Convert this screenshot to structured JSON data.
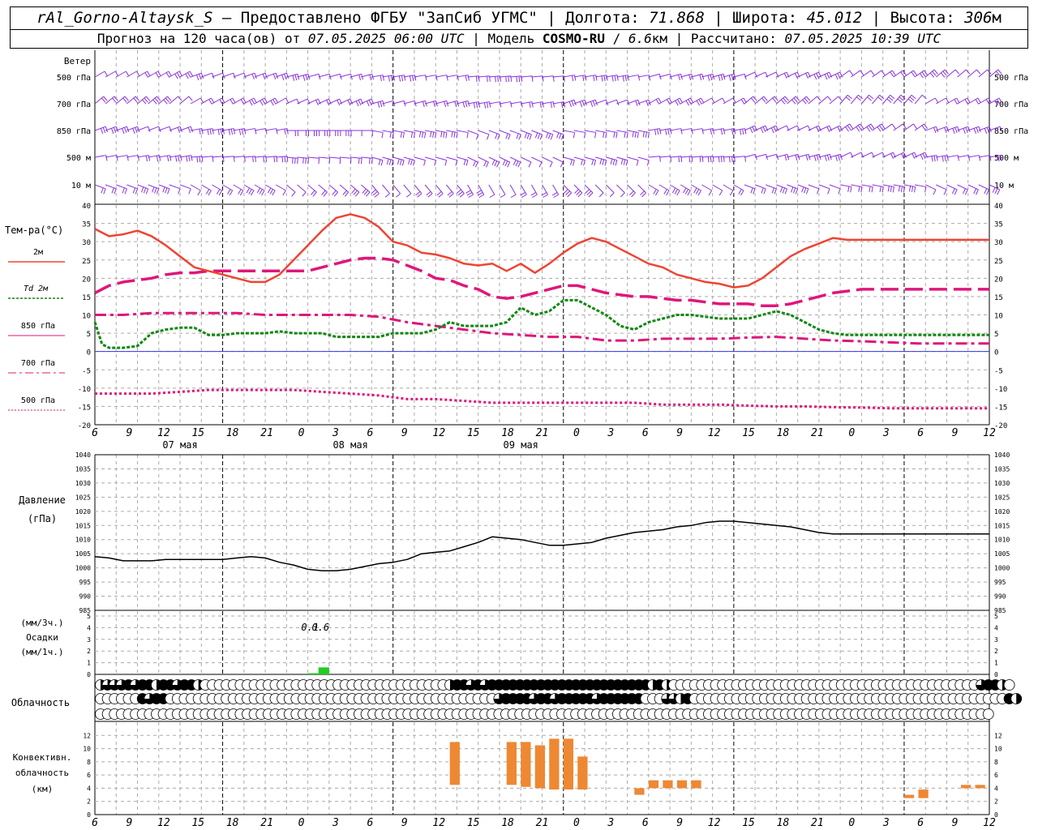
{
  "header": {
    "station": "rAl_Gorno-Altaysk_S",
    "dash": " – ",
    "provided": "Предоставлено ФГБУ \"ЗапСиб УГМС\"",
    "sep": " | ",
    "lon_label": "Долгота: ",
    "lon": "71.868",
    "lat_label": "Широта: ",
    "lat": "45.012",
    "alt_label": "Высота: ",
    "alt": "306",
    "alt_unit": "м",
    "forecast_label": "Прогноз на 120 часа(ов) от ",
    "forecast_time": "07.05.2025 06:00 UTC",
    "model_sep": "  | Модель ",
    "model": "COSMO-RU",
    "model_res_sep": " / ",
    "model_res": "6.6",
    "model_res_unit": "км",
    "calc_label": " | Рассчитано: ",
    "calc_time": "07.05.2025 10:39 UTC"
  },
  "colors": {
    "t2m": "#ee4433",
    "td2m": "#118811",
    "t850": "#e0167a",
    "t700": "#e0167a",
    "t500": "#e0167a",
    "wind": "#8833dd",
    "precip": "#22cc22",
    "convective": "#ee8833",
    "zero_line": "#3333ee",
    "grid": "#aaaaaa"
  },
  "x_axis": {
    "hour_ticks": [
      "6",
      "9",
      "12",
      "15",
      "18",
      "21",
      "0",
      "3",
      "6",
      "9",
      "12",
      "15",
      "18",
      "21",
      "0",
      "3",
      "6",
      "9",
      "12",
      "15",
      "18",
      "21",
      "0",
      "3",
      "6",
      "9",
      "12"
    ],
    "date_labels": [
      "07 мая",
      "08 мая",
      "09 мая"
    ]
  },
  "wind": {
    "title": "Ветер",
    "levels": [
      "500 гПа",
      "700 гПа",
      "850 гПа",
      "500 м",
      "10  м"
    ]
  },
  "temperature": {
    "label": "Тем-ра(°C)",
    "legend": [
      {
        "key": "t2m",
        "label": "2м"
      },
      {
        "key": "td2m",
        "label": "Td 2м"
      },
      {
        "key": "t850",
        "label": "850 гПа"
      },
      {
        "key": "t700",
        "label": "700 гПа"
      },
      {
        "key": "t500",
        "label": "500 гПа"
      }
    ],
    "y_ticks": [
      "40",
      "35",
      "30",
      "25",
      "20",
      "15",
      "10",
      "5",
      "0",
      "-5",
      "-10",
      "-15",
      "-20"
    ]
  },
  "pressure": {
    "label1": "Давление",
    "label2": "(гПа)",
    "y_ticks": [
      "1040",
      "1035",
      "1030",
      "1025",
      "1020",
      "1015",
      "1010",
      "1005",
      "1000",
      "995",
      "990",
      "985"
    ]
  },
  "precip": {
    "label1": "(мм/3ч.)",
    "label2": "Осадки",
    "label3": "(мм/1ч.)",
    "y_ticks": [
      "5",
      "4",
      "3",
      "2",
      "1",
      "0"
    ],
    "value_labels": [
      "0.1",
      "0.6"
    ]
  },
  "cloud": {
    "label": "Облачность"
  },
  "convective": {
    "label1": "Конвективн.",
    "label2": "облачность",
    "label3": "(км)",
    "y_ticks": [
      "12",
      "10",
      "8",
      "6",
      "4",
      "2",
      "0"
    ]
  },
  "chart_data": {
    "type": "meteogram",
    "x_hours_from_start": "0..126, start 07.05.2025 06:00 UTC",
    "t2m": {
      "x": [
        0,
        2,
        4,
        6,
        8,
        10,
        12,
        14,
        16,
        18,
        20,
        22,
        24,
        26,
        28,
        30,
        32,
        34,
        36,
        38,
        40,
        42,
        44,
        46,
        48,
        50,
        52,
        54,
        56,
        58,
        60,
        62,
        64,
        66,
        68,
        70,
        72,
        74,
        76,
        78,
        80,
        82,
        84,
        86,
        88,
        90,
        92,
        94,
        96,
        98,
        100,
        102,
        104,
        106,
        108,
        110,
        112,
        114,
        116,
        118,
        120,
        122,
        124,
        126
      ],
      "y": [
        33.5,
        31.5,
        32,
        33,
        31.5,
        29,
        26,
        23,
        22,
        21,
        20,
        19,
        19,
        21,
        25,
        29,
        33,
        36.5,
        37.5,
        36.5,
        34,
        30,
        29,
        27,
        26.5,
        25.5,
        24,
        23.5,
        24,
        22,
        24,
        21.5,
        24,
        27,
        29.5,
        31,
        30,
        28,
        26,
        24,
        23,
        21,
        20,
        19,
        18.5,
        17.5,
        18,
        20,
        23,
        26,
        28,
        29.5,
        31,
        30.5,
        30.5,
        30.5,
        30.5,
        30.5,
        30.5,
        30.5,
        30.5,
        30.5,
        30.5,
        30.5
      ]
    },
    "td2m": {
      "x": [
        0,
        1,
        2,
        4,
        6,
        8,
        10,
        12,
        14,
        16,
        18,
        20,
        22,
        24,
        26,
        28,
        30,
        32,
        34,
        36,
        38,
        40,
        42,
        44,
        46,
        48,
        50,
        52,
        54,
        56,
        58,
        60,
        62,
        64,
        66,
        68,
        70,
        72,
        74,
        76,
        78,
        80,
        82,
        84,
        86,
        88,
        90,
        92,
        94,
        96,
        98,
        100,
        102,
        104,
        106,
        108,
        110,
        112,
        114,
        116,
        118,
        120,
        122,
        124,
        126
      ],
      "y": [
        8,
        2,
        1,
        1,
        1.5,
        5,
        6,
        6.5,
        6.5,
        4.5,
        4.5,
        5,
        5,
        5,
        5.5,
        5,
        5,
        5,
        4,
        4,
        4,
        4,
        5,
        5,
        5,
        6,
        8,
        7,
        7,
        7,
        8,
        12,
        10,
        11,
        14,
        14,
        12,
        10,
        7,
        6,
        8,
        9,
        10,
        10,
        9.5,
        9,
        9,
        9,
        10,
        11,
        10,
        8,
        6,
        5,
        4.5,
        4.5,
        4.5,
        4.5,
        4.5,
        4.5,
        4.5,
        4.5,
        4.5,
        4.5,
        4.5
      ]
    },
    "t850": {
      "x": [
        0,
        2,
        4,
        6,
        8,
        10,
        12,
        14,
        16,
        18,
        20,
        22,
        24,
        26,
        28,
        30,
        32,
        34,
        36,
        38,
        40,
        42,
        44,
        46,
        48,
        50,
        52,
        54,
        56,
        58,
        60,
        62,
        64,
        66,
        68,
        70,
        72,
        74,
        76,
        78,
        80,
        82,
        84,
        86,
        88,
        90,
        92,
        94,
        96,
        98,
        100,
        102,
        104,
        106,
        108,
        110,
        112,
        114,
        116,
        118,
        120,
        122,
        124,
        126
      ],
      "y": [
        16,
        18,
        19,
        19.5,
        20,
        21,
        21.5,
        21.5,
        22,
        22,
        22,
        22,
        22,
        22,
        22,
        22,
        23,
        24,
        25,
        25.5,
        25.5,
        25,
        23.5,
        22,
        20,
        19.5,
        18,
        17,
        15,
        14.5,
        15,
        16,
        17,
        18,
        18,
        17,
        16,
        15.5,
        15,
        15,
        14.5,
        14,
        14,
        13.5,
        13,
        13,
        13,
        12.5,
        12.5,
        13,
        14,
        15,
        16,
        16.5,
        17,
        17,
        17,
        17,
        17,
        17,
        17,
        17,
        17,
        17
      ]
    },
    "t700": {
      "x": [
        0,
        4,
        8,
        12,
        16,
        20,
        24,
        28,
        32,
        36,
        40,
        44,
        48,
        52,
        56,
        60,
        64,
        68,
        72,
        76,
        80,
        84,
        88,
        92,
        96,
        100,
        104,
        108,
        112,
        116,
        120,
        124,
        126
      ],
      "y": [
        10,
        10,
        10.5,
        10.5,
        10.5,
        10.5,
        10,
        10,
        10,
        10,
        9.5,
        8,
        7,
        6,
        5,
        4.5,
        4,
        4,
        3,
        3,
        3.5,
        3.5,
        3.5,
        3.8,
        4,
        3.5,
        3,
        2.8,
        2.5,
        2.2,
        2.2,
        2.2,
        2.2
      ]
    },
    "t500": {
      "x": [
        0,
        4,
        8,
        12,
        16,
        20,
        24,
        28,
        32,
        36,
        40,
        44,
        48,
        52,
        56,
        60,
        64,
        68,
        72,
        76,
        80,
        84,
        88,
        92,
        96,
        100,
        104,
        108,
        112,
        116,
        120,
        124,
        126
      ],
      "y": [
        -11.5,
        -11.5,
        -11.5,
        -11,
        -10.5,
        -10.5,
        -10.5,
        -10.5,
        -11,
        -11.5,
        -12,
        -13,
        -13,
        -13.5,
        -14,
        -14,
        -14,
        -14,
        -14,
        -14,
        -14.5,
        -14.5,
        -14.5,
        -14.8,
        -15,
        -15,
        -15.2,
        -15.3,
        -15.5,
        -15.5,
        -15.5,
        -15.5,
        -15.5
      ]
    },
    "pressure": {
      "x": [
        0,
        2,
        4,
        6,
        8,
        10,
        12,
        14,
        16,
        18,
        20,
        22,
        24,
        26,
        28,
        30,
        32,
        34,
        36,
        38,
        40,
        42,
        44,
        46,
        48,
        50,
        52,
        54,
        56,
        58,
        60,
        62,
        64,
        66,
        68,
        70,
        72,
        74,
        76,
        78,
        80,
        82,
        84,
        86,
        88,
        90,
        92,
        94,
        96,
        98,
        100,
        102,
        104,
        106,
        108,
        110,
        112,
        114,
        116,
        118,
        120,
        122,
        124,
        126
      ],
      "y": [
        1004,
        1003.5,
        1002.5,
        1002.5,
        1002.5,
        1003,
        1003,
        1003,
        1003,
        1003,
        1003.5,
        1004,
        1003.5,
        1002,
        1001,
        999.5,
        999,
        999,
        999.5,
        1000.5,
        1001.5,
        1002,
        1003,
        1005,
        1005.5,
        1006,
        1007.5,
        1009,
        1011,
        1010.5,
        1010,
        1009,
        1008,
        1008,
        1008.5,
        1009,
        1010.5,
        1011.5,
        1012.5,
        1013,
        1013.5,
        1014.5,
        1015,
        1016,
        1016.5,
        1016.5,
        1016,
        1015.5,
        1015,
        1014.5,
        1013.5,
        1012.5,
        1012,
        1012,
        1012,
        1012,
        1012,
        1012,
        1012,
        1012,
        1012,
        1012,
        1012,
        1012
      ]
    },
    "precip_bars": [
      {
        "x_start": 30,
        "x_end": 31.5,
        "value": 0.1
      },
      {
        "x_start": 31.5,
        "x_end": 33,
        "value": 0.6
      }
    ],
    "cloud_rows": [
      [
        2,
        3,
        3,
        3,
        4,
        3,
        4,
        4,
        2,
        4,
        4,
        3,
        4,
        4,
        2,
        0,
        0,
        0,
        0,
        0,
        0,
        0,
        0,
        0,
        0,
        0,
        0,
        0,
        0,
        0,
        0,
        0,
        0,
        0,
        0,
        0,
        0,
        0,
        0,
        0,
        0,
        0,
        0,
        0,
        0,
        0,
        0,
        0,
        0,
        0,
        2,
        4,
        4,
        3,
        4,
        3,
        4,
        4,
        4,
        4,
        4,
        4,
        4,
        4,
        4,
        4,
        4,
        4,
        4,
        4,
        4,
        4,
        4,
        4,
        4,
        4,
        4,
        4,
        4,
        2,
        4,
        2,
        0,
        0,
        0,
        0,
        0,
        0,
        0,
        0,
        0,
        0,
        0,
        0,
        0,
        0,
        0,
        0,
        0,
        0,
        0,
        0,
        0,
        0,
        0,
        0,
        0,
        0,
        0,
        0,
        0,
        0,
        0,
        0,
        0,
        0,
        0,
        0,
        0,
        0,
        0,
        0,
        0,
        0,
        0,
        0,
        3,
        4,
        4,
        2,
        0
      ],
      [
        0,
        0,
        0,
        0,
        0,
        0,
        4,
        3,
        4,
        4,
        0,
        0,
        0,
        0,
        0,
        0,
        0,
        0,
        0,
        0,
        0,
        0,
        0,
        0,
        0,
        0,
        0,
        0,
        0,
        0,
        0,
        0,
        0,
        0,
        0,
        0,
        0,
        0,
        0,
        0,
        0,
        0,
        0,
        0,
        0,
        0,
        0,
        0,
        0,
        0,
        0,
        0,
        0,
        0,
        0,
        0,
        0,
        3,
        4,
        4,
        4,
        4,
        3,
        4,
        4,
        3,
        4,
        4,
        4,
        4,
        4,
        3,
        4,
        4,
        4,
        4,
        4,
        4,
        0,
        0,
        0,
        3,
        3,
        2,
        4,
        0,
        0,
        0,
        0,
        0,
        0,
        0,
        0,
        0,
        0,
        0,
        0,
        0,
        0,
        0,
        0,
        0,
        0,
        0,
        0,
        0,
        0,
        0,
        0,
        0,
        0,
        0,
        0,
        0,
        0,
        0,
        0,
        0,
        0,
        0,
        0,
        0,
        0,
        0,
        0,
        0,
        0,
        0,
        0,
        0,
        4,
        2
      ],
      [
        0,
        0,
        0,
        0,
        0,
        0,
        0,
        0,
        0,
        0,
        0,
        0,
        0,
        0,
        0,
        0,
        0,
        0,
        0,
        0,
        0,
        0,
        0,
        0,
        0,
        0,
        0,
        0,
        0,
        0,
        0,
        0,
        0,
        0,
        0,
        0,
        0,
        0,
        0,
        0,
        0,
        0,
        0,
        0,
        0,
        0,
        0,
        0,
        0,
        0,
        0,
        0,
        0,
        0,
        0,
        0,
        0,
        0,
        0,
        0,
        0,
        0,
        0,
        0,
        0,
        0,
        0,
        0,
        0,
        0,
        0,
        0,
        0,
        0,
        0,
        0,
        0,
        0,
        0,
        0,
        0,
        0,
        0,
        0,
        0,
        0,
        0,
        0,
        0,
        0,
        0,
        0,
        0,
        0,
        0,
        0,
        0,
        0,
        0,
        0,
        0,
        0,
        0,
        0,
        0,
        0,
        0,
        0,
        0,
        0,
        0,
        0,
        0,
        0,
        0,
        0,
        0,
        0,
        0,
        0,
        0,
        0,
        0,
        0,
        0,
        0,
        0,
        0
      ]
    ],
    "convective_bars": [
      {
        "x": 25,
        "bottom": 4.5,
        "top": 11
      },
      {
        "x": 29,
        "bottom": 4.5,
        "top": 11
      },
      {
        "x": 30,
        "bottom": 4.2,
        "top": 11
      },
      {
        "x": 31,
        "bottom": 4,
        "top": 10.5
      },
      {
        "x": 32,
        "bottom": 3.8,
        "top": 11.5
      },
      {
        "x": 33,
        "bottom": 3.8,
        "top": 11.5
      },
      {
        "x": 34,
        "bottom": 3.8,
        "top": 8.8
      },
      {
        "x": 38,
        "bottom": 3,
        "top": 4
      },
      {
        "x": 39,
        "bottom": 4,
        "top": 5.2
      },
      {
        "x": 40,
        "bottom": 4,
        "top": 5.2
      },
      {
        "x": 41,
        "bottom": 4,
        "top": 5.2
      },
      {
        "x": 42,
        "bottom": 4,
        "top": 5.2
      },
      {
        "x": 57,
        "bottom": 2.5,
        "top": 3
      },
      {
        "x": 58,
        "bottom": 2.5,
        "top": 3.8
      },
      {
        "x": 61,
        "bottom": 4,
        "top": 4.5
      },
      {
        "x": 62,
        "bottom": 4,
        "top": 4.5
      }
    ],
    "convective_step_hours": 2
  }
}
